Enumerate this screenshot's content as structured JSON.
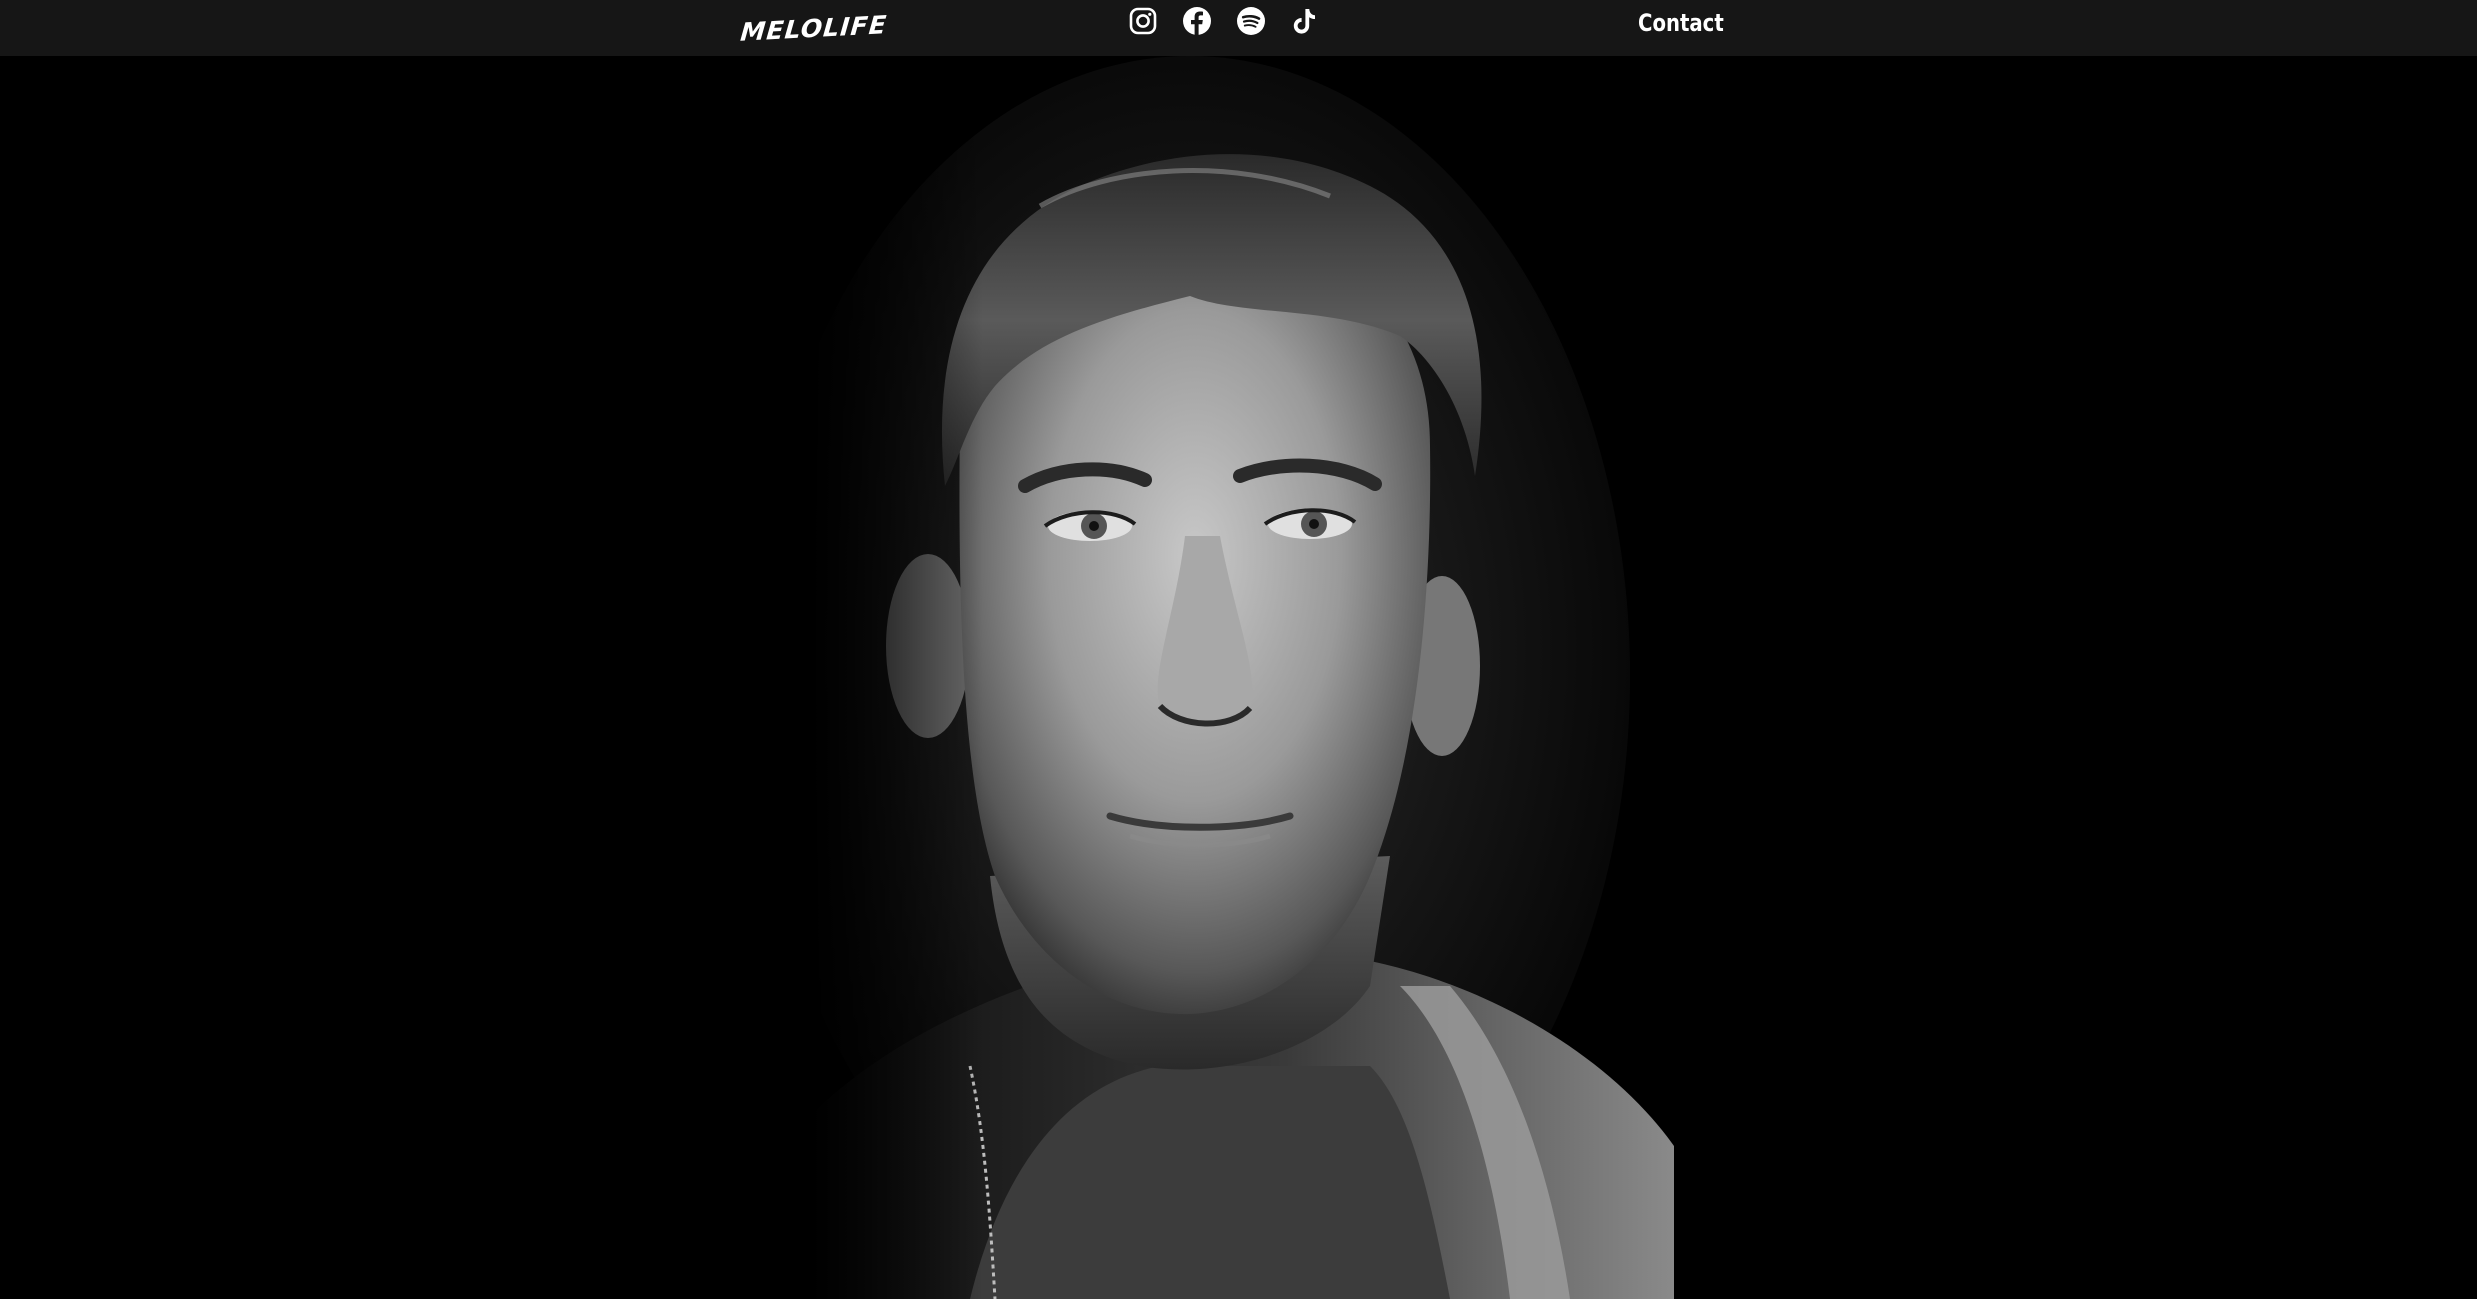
{
  "header": {
    "logo_text": "MELOLIFE",
    "socials": [
      {
        "name": "Instagram",
        "icon": "instagram-icon"
      },
      {
        "name": "Facebook",
        "icon": "facebook-icon"
      },
      {
        "name": "Spotify",
        "icon": "spotify-icon"
      },
      {
        "name": "TikTok",
        "icon": "tiktok-icon"
      }
    ],
    "contact_label": "Contact"
  },
  "hero": {
    "image_description": "",
    "style": "black-and-white portrait on black background"
  },
  "colors": {
    "header_bg": "#161616",
    "page_bg": "#000000",
    "text": "#ffffff"
  }
}
